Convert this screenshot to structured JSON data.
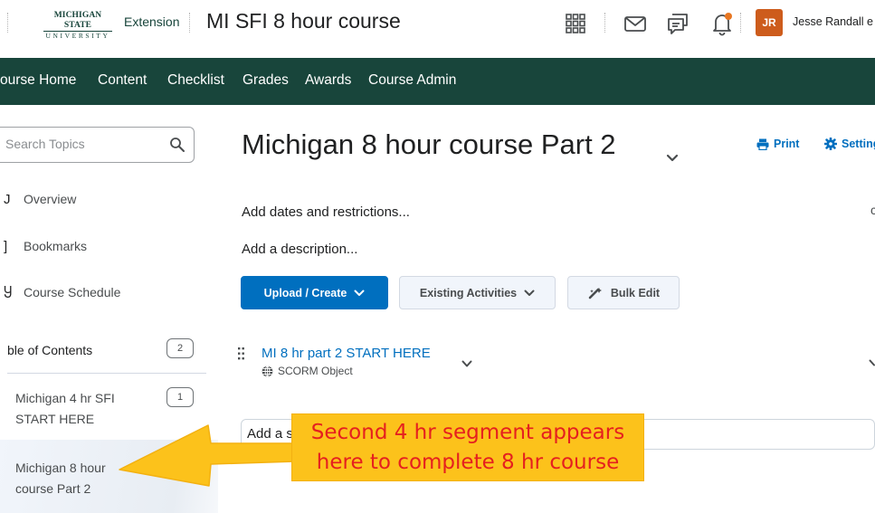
{
  "header": {
    "logo_line1": "MICHIGAN STATE",
    "logo_line2": "UNIVERSITY",
    "logo_extension": "Extension",
    "course_title": "MI SFI 8 hour course",
    "user_initials": "JR",
    "user_name": "Jesse Randall",
    "user_name_clip": "Jesse Randall e",
    "icons": [
      "grid-icon",
      "mail-icon",
      "chat-icon",
      "bell-icon"
    ],
    "notification_color": "#e87722",
    "avatar_color": "#cd5c1c"
  },
  "nav": {
    "items": [
      {
        "label": "ourse Home"
      },
      {
        "label": "Content"
      },
      {
        "label": "Checklist"
      },
      {
        "label": "Grades"
      },
      {
        "label": "Awards"
      },
      {
        "label": "Course Admin"
      }
    ],
    "background": "#18453b"
  },
  "sidebar": {
    "search_placeholder": "Search Topics",
    "items": [
      {
        "glyph": "J",
        "label": "Overview"
      },
      {
        "glyph": "]",
        "label": "Bookmarks"
      },
      {
        "glyph": "Ⴘ",
        "label": "Course Schedule"
      }
    ],
    "toc": {
      "label": "ble of Contents",
      "count": "2",
      "entries": [
        {
          "line1": "Michigan 4 hr SFI",
          "line2": "START HERE",
          "count": "1"
        },
        {
          "line1": "Michigan 8 hour",
          "line2": "course Part 2"
        }
      ]
    }
  },
  "main": {
    "title": "Michigan 8 hour course Part 2",
    "print_label": "Print",
    "settings_label": "Settings",
    "dates_link": "Add dates and restrictions...",
    "description_link": "Add a description...",
    "edge_glyph": "c",
    "buttons": {
      "upload": "Upload / Create",
      "existing": "Existing Activities",
      "bulk_edit": "Bulk Edit"
    },
    "activity": {
      "title": "MI 8 hr part 2 START HERE",
      "type": "SCORM Object"
    },
    "add_input_placeholder": "Add a s"
  },
  "callout": {
    "line1": "Second 4 hr segment appears",
    "line2": "here to complete 8 hr course",
    "fill": "#fcc21b",
    "text_color": "#e5201f"
  }
}
